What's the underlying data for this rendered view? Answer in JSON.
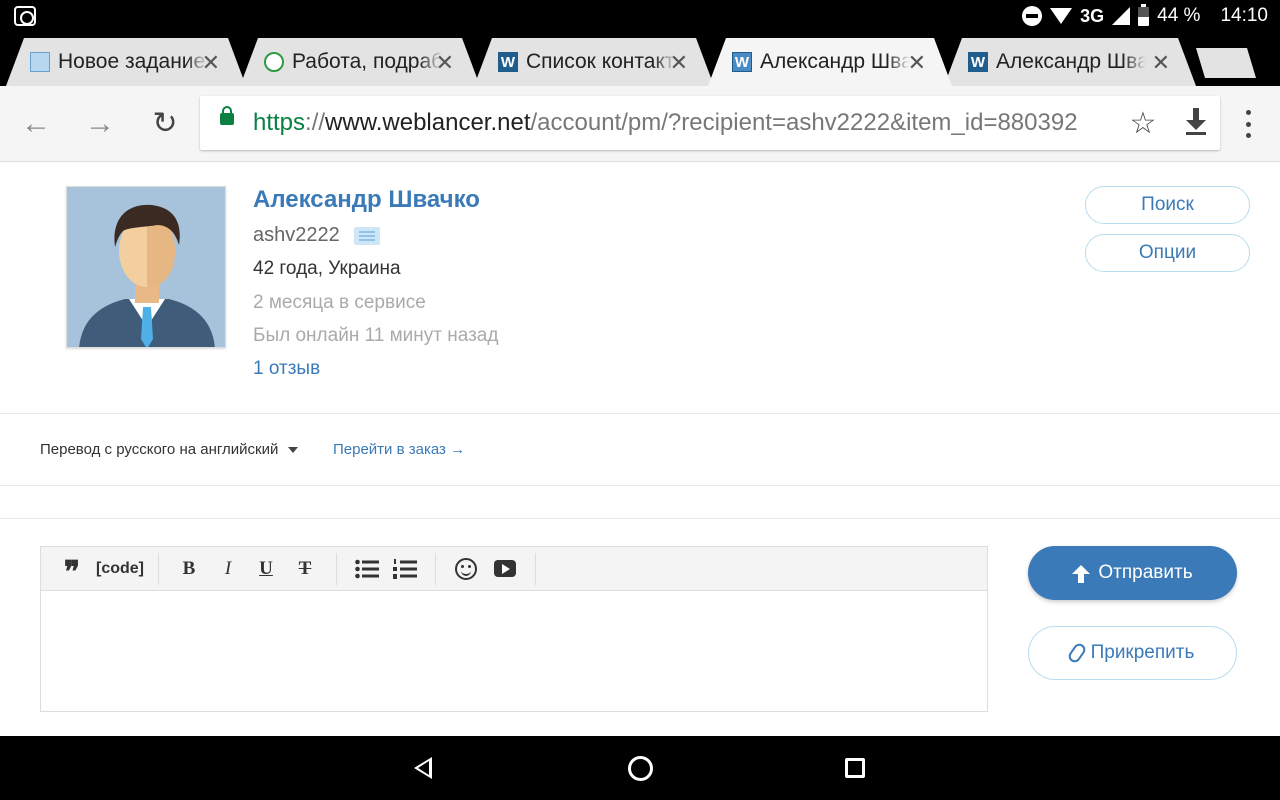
{
  "status_bar": {
    "network": "3G",
    "battery": "44 %",
    "time": "14:10"
  },
  "tabs": [
    {
      "title": "Новое задание",
      "icon": "image-favicon-icon",
      "active": false
    },
    {
      "title": "Работа, подраб",
      "icon": "green-face-favicon-icon",
      "active": false
    },
    {
      "title": "Список контакт",
      "icon": "weblancer-favicon-icon",
      "favicon_text": "W",
      "active": false
    },
    {
      "title": "Александр Шва",
      "icon": "weblancer-favicon-icon",
      "favicon_text": "W",
      "active": true
    },
    {
      "title": "Александр Шва",
      "icon": "weblancer-favicon-icon",
      "favicon_text": "W",
      "active": false
    }
  ],
  "toolbar": {
    "back": "←",
    "forward": "→",
    "reload": "↻",
    "url": {
      "scheme": "https",
      "separator": "://",
      "host": "www.weblancer.net",
      "path": "/account/pm/?recipient=ashv2222&item_id=880392"
    },
    "star": "☆"
  },
  "profile": {
    "name": "Александр Швачко",
    "login": "ashv2222",
    "age_country": "42 года, Украина",
    "service_time": "2 месяца в сервисе",
    "last_online": "Был онлайн 11 минут назад",
    "reviews": "1 отзыв"
  },
  "actions": {
    "search": "Поиск",
    "options": "Опции"
  },
  "order": {
    "title": "Перевод с русского на английский",
    "goto": "Перейти в заказ →"
  },
  "editor": {
    "code_label": "[code]",
    "bold": "B",
    "italic": "I",
    "underline": "U",
    "strike": "T",
    "quote": "❞",
    "value": ""
  },
  "buttons": {
    "send": "Отправить",
    "attach": "Прикрепить"
  },
  "colors": {
    "accent": "#3a7ab8",
    "secure": "#0b8043"
  }
}
